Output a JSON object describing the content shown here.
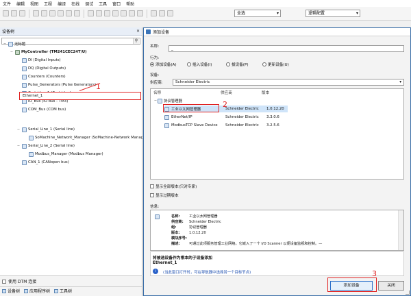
{
  "menu": [
    "文件",
    "编辑",
    "视图",
    "工程",
    "编译",
    "在线",
    "调试",
    "工具",
    "窗口",
    "帮助"
  ],
  "toolbar": {
    "combo1": "全选",
    "combo2": "逻辑配置"
  },
  "left_panel": {
    "title": "设备树",
    "close": "×",
    "search_value": "",
    "tree": [
      {
        "label": "无标题",
        "level": 0,
        "exp": "−"
      },
      {
        "label": "MyController (TM241CEC24T/U)",
        "level": 1,
        "exp": "−",
        "bold": true
      },
      {
        "label": "DI (Digital Inputs)",
        "level": 2,
        "exp": ""
      },
      {
        "label": "DQ (Digital Outputs)",
        "level": 2,
        "exp": ""
      },
      {
        "label": "Counters (Counters)",
        "level": 2,
        "exp": ""
      },
      {
        "label": "Pulse_Generators (Pulse Generators)",
        "level": 2,
        "exp": ""
      },
      {
        "label": "Cartridge_1 (Cartridge)",
        "level": 2,
        "exp": ""
      },
      {
        "label": "IO_Bus (IO bus - TM3)",
        "level": 2,
        "exp": ""
      },
      {
        "label": "COM_Bus (COM bus)",
        "level": 2,
        "exp": ""
      }
    ],
    "tree2": [
      {
        "label": "Serial_Line_1 (Serial line)",
        "level": 2,
        "exp": "−"
      },
      {
        "label": "SoMachine_Network_Manager (SoMachine-Network Manager)",
        "level": 3,
        "exp": ""
      },
      {
        "label": "Serial_Line_2 (Serial line)",
        "level": 2,
        "exp": "−"
      },
      {
        "label": "Modbus_Manager (Modbus Manager)",
        "level": 3,
        "exp": ""
      },
      {
        "label": "CAN_1 (CANopen bus)",
        "level": 2,
        "exp": ""
      }
    ],
    "ethernet_node": "Ethernet_1",
    "marker1": "1",
    "footer_check": "使用 DTM 连接",
    "tabs": [
      "设备树",
      "应用程序树",
      "工具树"
    ]
  },
  "dialog": {
    "title": "添加设备",
    "name_label": "名称:",
    "name_value": "_",
    "action_label": "行为:",
    "actions": [
      {
        "label": "添加设备(A)",
        "checked": true
      },
      {
        "label": "插入设备(I)",
        "checked": false
      },
      {
        "label": "拔设备(P)",
        "checked": false
      },
      {
        "label": "更新设备(U)",
        "checked": false
      }
    ],
    "device_label": "设备:",
    "vendor_label": "供应商:",
    "vendor_value": "Schneider Electric",
    "columns": [
      "名称",
      "供应商",
      "版本"
    ],
    "group": "协议管理器",
    "devices": [
      {
        "name": "工业以太网管理器",
        "vendor": "Schneider Electric",
        "version": "1.0.12.20",
        "selected": true
      },
      {
        "name": "EtherNet/IP",
        "vendor": "Schneider Electric",
        "version": "3.3.0.6",
        "selected": false
      },
      {
        "name": "ModbusTCP Slave Device",
        "vendor": "Schneider Electric",
        "version": "3.2.5.6",
        "selected": false
      }
    ],
    "marker2": "2",
    "check_all_versions": "显示全部版本(只对专家)",
    "check_old_versions": "显示过期版本",
    "info_label": "信息:",
    "info_lines": [
      {
        "k": "名称:",
        "v": "工业以太网管理器"
      },
      {
        "k": "供应商:",
        "v": "Schneider Electric"
      },
      {
        "k": "组:",
        "v": "协议管理器"
      },
      {
        "k": "版本:",
        "v": "1.0.12.20"
      },
      {
        "k": "模块序号:",
        "v": ""
      },
      {
        "k": "描述:",
        "v": "可通过此项服务管理工业网络。它嵌入了一个 I/O Scanner 以便设备监视和控制。—"
      }
    ],
    "note_title": "将被选设备作为根本的子设备添加",
    "note_target": "Ethernet_1",
    "note_tip": "(当此窗口打开时，可在导航器中选择另一个目标节点)",
    "add_button": "添加设备",
    "close_button": "关闭",
    "marker3": "3"
  }
}
